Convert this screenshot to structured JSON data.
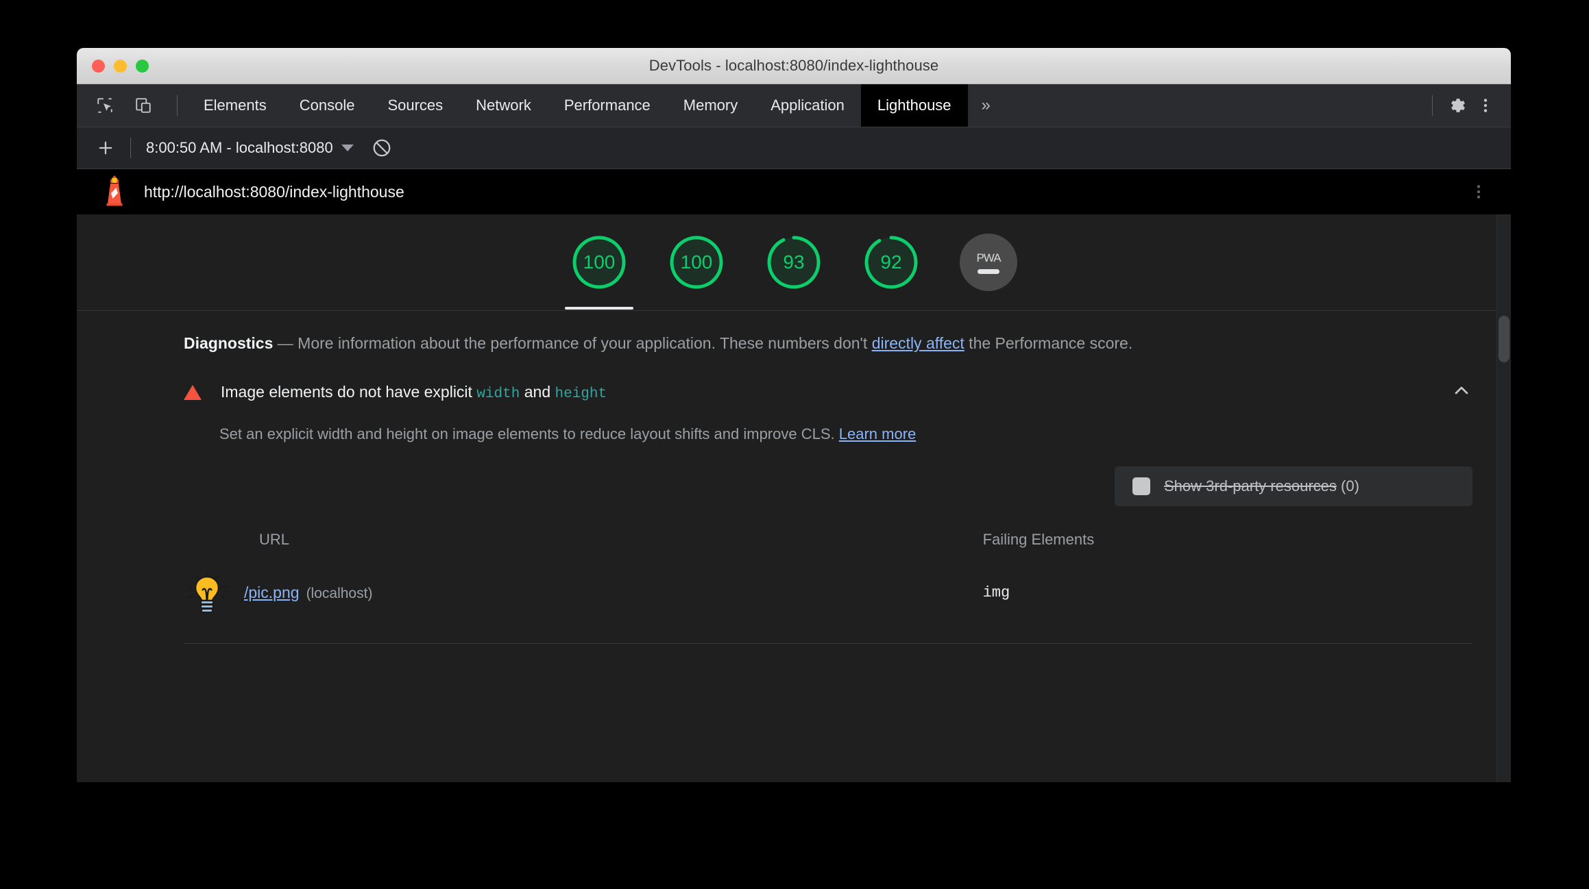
{
  "window": {
    "title": "DevTools - localhost:8080/index-lighthouse",
    "traffic_lights": [
      "close",
      "minimize",
      "zoom"
    ]
  },
  "devtools": {
    "inspect_icon": "inspect-element-icon",
    "device_icon": "device-toolbar-icon",
    "tabs": [
      {
        "label": "Elements",
        "selected": false
      },
      {
        "label": "Console",
        "selected": false
      },
      {
        "label": "Sources",
        "selected": false
      },
      {
        "label": "Network",
        "selected": false
      },
      {
        "label": "Performance",
        "selected": false
      },
      {
        "label": "Memory",
        "selected": false
      },
      {
        "label": "Application",
        "selected": false
      },
      {
        "label": "Lighthouse",
        "selected": true
      }
    ],
    "overflow_label": "»",
    "settings_icon": "gear-icon",
    "more_icon": "vertical-dots-icon"
  },
  "lighthouse_toolbar": {
    "add_icon": "plus-icon",
    "run_label": "8:00:50 AM - localhost:8080",
    "dropdown_icon": "chevron-down-icon",
    "clear_icon": "no-entry-clear-icon"
  },
  "report": {
    "logo": "lighthouse-logo-icon",
    "url": "http://localhost:8080/index-lighthouse",
    "menu_icon": "vertical-dots-icon",
    "categories": [
      {
        "score": "100",
        "selected": true
      },
      {
        "score": "100",
        "selected": false
      },
      {
        "score": "93",
        "selected": false
      },
      {
        "score": "92",
        "selected": false
      }
    ],
    "pwa": {
      "label": "PWA",
      "state": "null-dash"
    },
    "accent_green": "#0cce6b",
    "intro": {
      "heading": "Diagnostics",
      "dash": "—",
      "text_before_link": "More information about the performance of your application. These numbers don't ",
      "link_text": "directly affect",
      "text_after_link": " the Performance score."
    },
    "audit": {
      "severity_icon": "warning-triangle-icon",
      "title_part1": "Image elements do not have explicit ",
      "code1": "width",
      "title_part2": " and ",
      "code2": "height",
      "collapse_icon": "chevron-up-icon",
      "description": "Set an explicit width and height on image elements to reduce layout shifts and improve CLS.",
      "description_link": "Learn more",
      "third_party": {
        "checkbox": "show-3rd-party-checkbox",
        "label": "Show 3rd-party resources",
        "count": "(0)"
      },
      "table": {
        "columns": [
          "URL",
          "Failing Elements"
        ],
        "rows": [
          {
            "thumbnail": "lightbulb-thumbnail",
            "url": "/pic.png",
            "host": "(localhost)",
            "failing_element": "img"
          }
        ]
      }
    }
  }
}
